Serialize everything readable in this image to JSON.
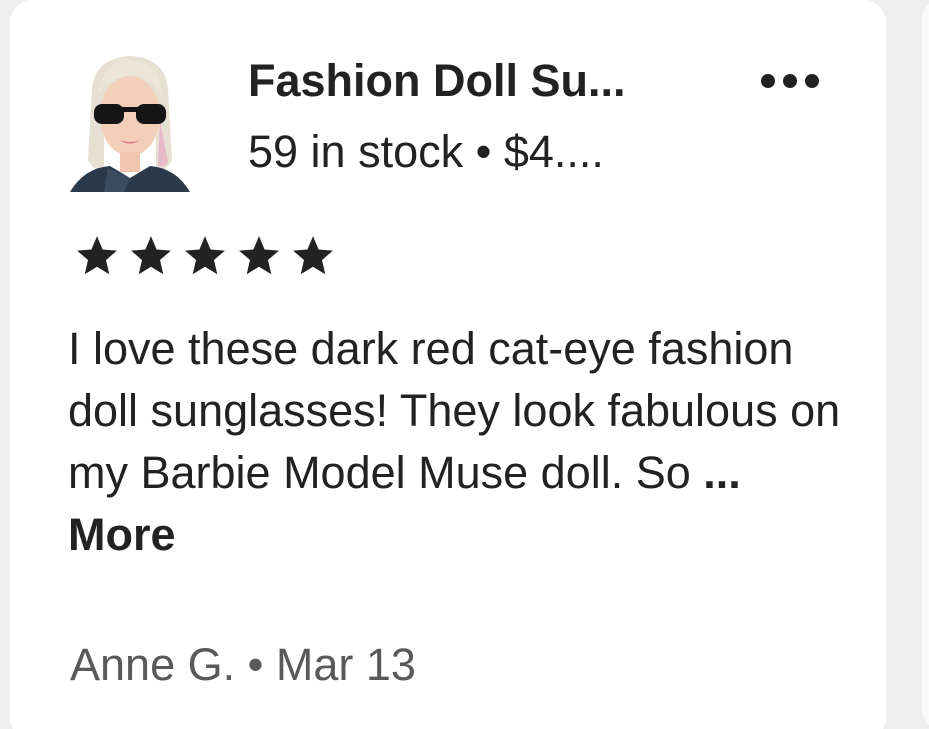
{
  "listing": {
    "title": "Fashion Doll Su...",
    "stock_price": "59 in stock • $4....",
    "thumbnail_icon": "doll-with-sunglasses-thumbnail"
  },
  "menu": {
    "icon": "more-horizontal-icon"
  },
  "review": {
    "rating": 5,
    "rating_max": 5,
    "star_color": "#222222",
    "text": "I love these dark red cat-eye fashion doll sunglasses!  They look fabulous on my Barbie Model Muse doll.  So",
    "ellipsis": " ...",
    "more_label": "More",
    "author": "Anne G.",
    "separator": " • ",
    "date": "Mar 13"
  },
  "colors": {
    "text_primary": "#222222",
    "text_secondary": "#595959",
    "card_bg": "#ffffff",
    "page_bg": "#efefef"
  }
}
